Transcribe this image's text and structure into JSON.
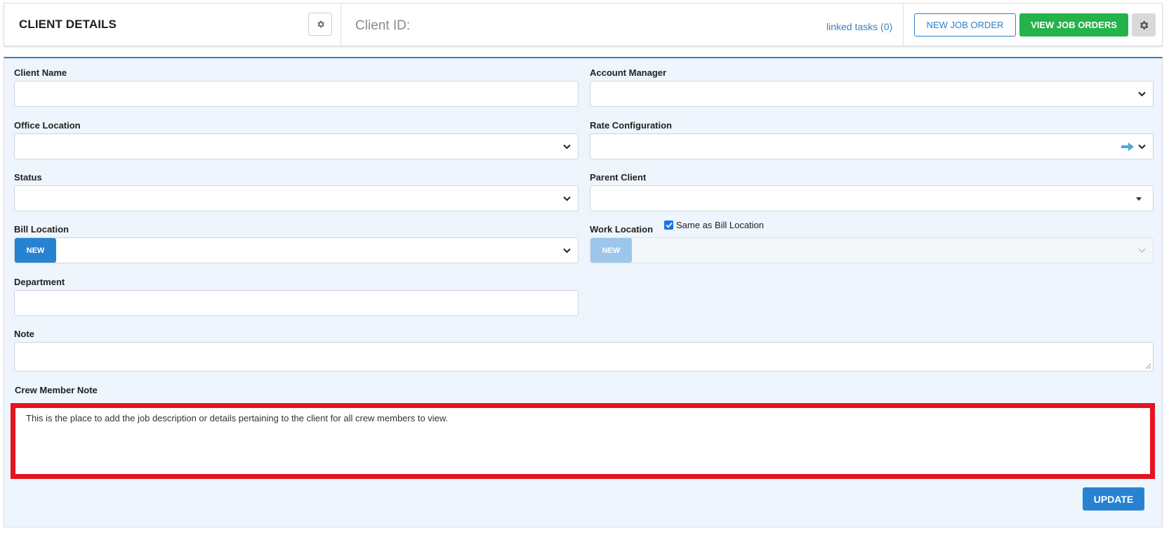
{
  "header": {
    "title": "CLIENT DETAILS",
    "client_id_label": "Client ID:",
    "linked_tasks": "linked tasks (0)",
    "new_job_order": "NEW JOB ORDER",
    "view_job_orders": "VIEW JOB ORDERS"
  },
  "form": {
    "client_name": {
      "label": "Client Name",
      "value": ""
    },
    "account_manager": {
      "label": "Account Manager",
      "value": ""
    },
    "office_location": {
      "label": "Office Location",
      "value": ""
    },
    "rate_configuration": {
      "label": "Rate Configuration",
      "value": ""
    },
    "status": {
      "label": "Status",
      "value": ""
    },
    "parent_client": {
      "label": "Parent Client",
      "value": ""
    },
    "bill_location": {
      "label": "Bill Location",
      "new_button": "NEW",
      "value": ""
    },
    "work_location": {
      "label": "Work Location",
      "new_button": "NEW",
      "same_as_bill_label": "Same as Bill Location",
      "same_as_bill_checked": true,
      "value": ""
    },
    "department": {
      "label": "Department",
      "value": ""
    },
    "note": {
      "label": "Note",
      "value": ""
    },
    "crew_member_note": {
      "label": "Crew Member Note",
      "value": "This is the place to add the job description or details pertaining to the client for all crew members to view."
    }
  },
  "actions": {
    "update": "UPDATE"
  },
  "colors": {
    "primary": "#2783d2",
    "success": "#24b24b",
    "highlight": "#e5141e",
    "panel_bg": "#eef5fc"
  }
}
